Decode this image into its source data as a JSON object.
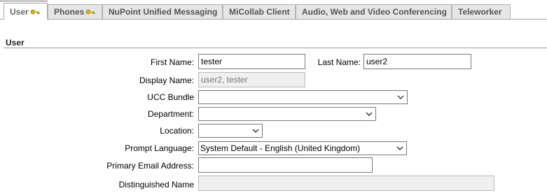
{
  "tabs": [
    {
      "label": "User",
      "active": true,
      "icon": "key-icon"
    },
    {
      "label": "Phones",
      "active": false,
      "icon": "key-icon"
    },
    {
      "label": "NuPoint Unified Messaging",
      "active": false
    },
    {
      "label": "MiCollab Client",
      "active": false
    },
    {
      "label": "Audio, Web and Video Conferencing",
      "active": false
    },
    {
      "label": "Teleworker",
      "active": false
    }
  ],
  "section": {
    "title": "User"
  },
  "form": {
    "first_name": {
      "label": "First Name:",
      "value": "tester"
    },
    "last_name": {
      "label": "Last Name:",
      "value": "user2"
    },
    "display_name": {
      "label": "Display Name:",
      "value": "user2, tester"
    },
    "ucc_bundle": {
      "label": "UCC Bundle",
      "value": ""
    },
    "department": {
      "label": "Department:",
      "value": ""
    },
    "location": {
      "label": "Location:",
      "value": ""
    },
    "prompt_language": {
      "label": "Prompt Language:",
      "value": "System Default - English (United Kingdom)"
    },
    "primary_email": {
      "label": "Primary Email Address:",
      "value": ""
    },
    "distinguished_name": {
      "label": "Distinguished Name",
      "value": ""
    }
  }
}
